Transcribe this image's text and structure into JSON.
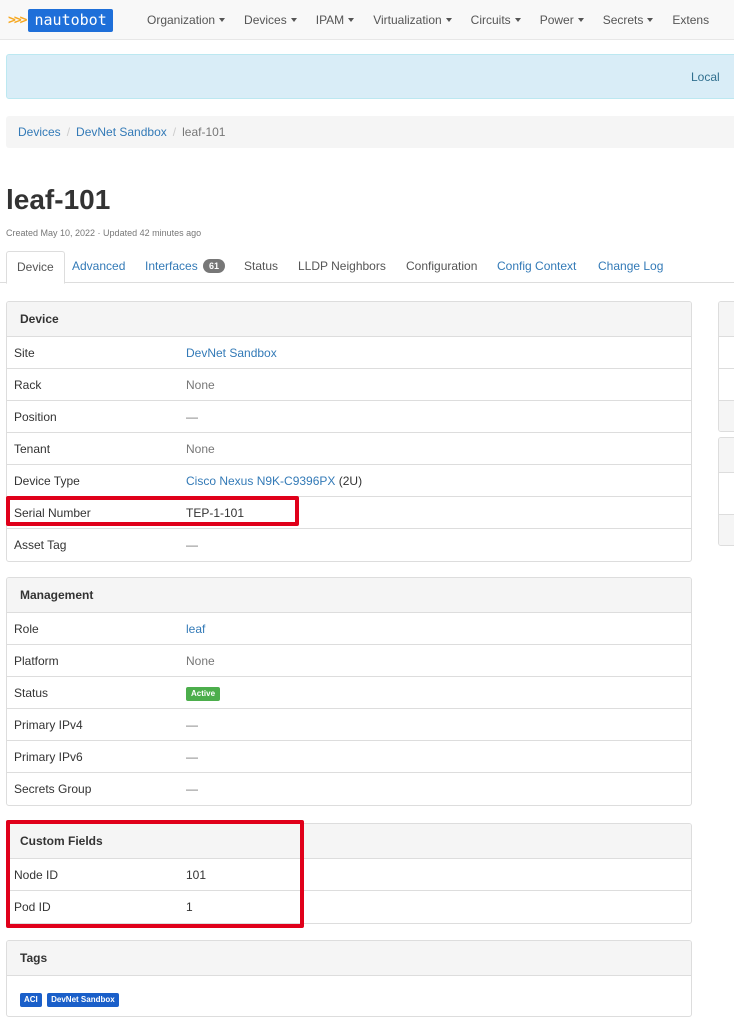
{
  "navbar": {
    "brand_chevrons": ">>>",
    "brand": "nautobot",
    "items": [
      "Organization",
      "Devices",
      "IPAM",
      "Virtualization",
      "Circuits",
      "Power",
      "Secrets",
      "Extens"
    ]
  },
  "alert": {
    "text": "Local"
  },
  "breadcrumb": {
    "items": [
      "Devices",
      "DevNet Sandbox",
      "leaf-101"
    ]
  },
  "page": {
    "title": "leaf-101",
    "meta": "Created May 10, 2022 · Updated 42 minutes ago"
  },
  "tabs": [
    {
      "label": "Device"
    },
    {
      "label": "Advanced"
    },
    {
      "label": "Interfaces",
      "badge": "61"
    },
    {
      "label": "Status"
    },
    {
      "label": "LLDP Neighbors"
    },
    {
      "label": "Configuration"
    },
    {
      "label": "Config Context"
    },
    {
      "label": "Change Log"
    }
  ],
  "device_panel": {
    "title": "Device",
    "rows": [
      {
        "key": "Site",
        "value": "DevNet Sandbox"
      },
      {
        "key": "Rack",
        "value": "None"
      },
      {
        "key": "Position",
        "value": "—"
      },
      {
        "key": "Tenant",
        "value": "None"
      },
      {
        "key": "Device Type",
        "value": "Cisco Nexus N9K-C9396PX",
        "suffix": "(2U)"
      },
      {
        "key": "Serial Number",
        "value": "TEP-1-101"
      },
      {
        "key": "Asset Tag",
        "value": "—"
      }
    ]
  },
  "management_panel": {
    "title": "Management",
    "rows": [
      {
        "key": "Role",
        "value": "leaf"
      },
      {
        "key": "Platform",
        "value": "None"
      },
      {
        "key": "Status",
        "value": "Active"
      },
      {
        "key": "Primary IPv4",
        "value": "—"
      },
      {
        "key": "Primary IPv6",
        "value": "—"
      },
      {
        "key": "Secrets Group",
        "value": "—"
      }
    ]
  },
  "custom_fields_panel": {
    "title": "Custom Fields",
    "rows": [
      {
        "key": "Node ID",
        "value": "101"
      },
      {
        "key": "Pod ID",
        "value": "1"
      }
    ]
  },
  "tags_panel": {
    "title": "Tags",
    "tags": [
      "ACI",
      "DevNet Sandbox"
    ]
  },
  "colors": {
    "link": "#337ab7",
    "brand": "#1e6fd9",
    "status_active": "#4cae4c",
    "tag": "#1a5fc9",
    "highlight": "#e0001a"
  }
}
